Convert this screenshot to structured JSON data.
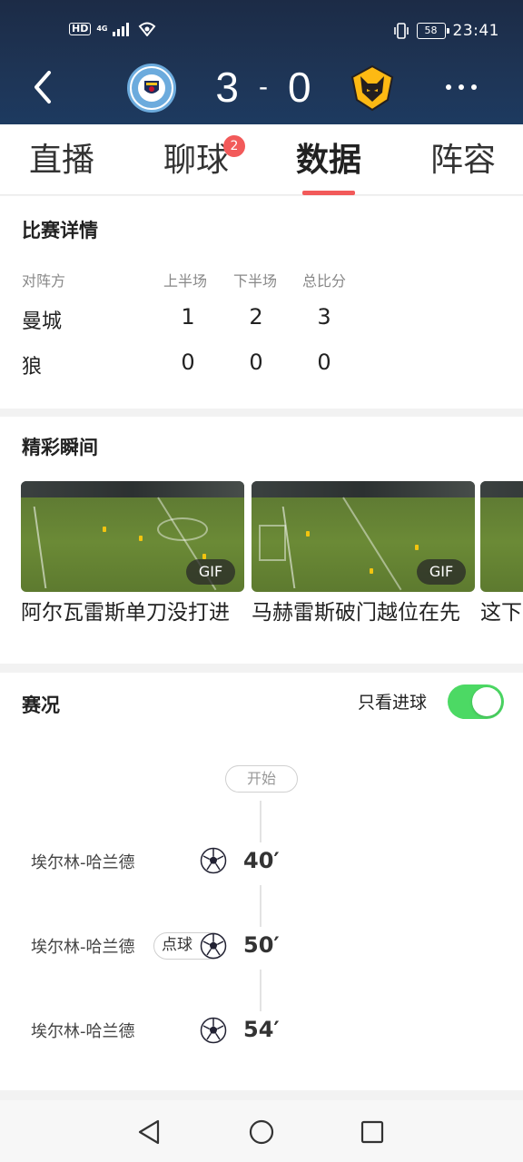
{
  "status_bar": {
    "hd": "HD",
    "net": "4G",
    "battery": "58",
    "time": "23:41"
  },
  "header": {
    "home_score": "3",
    "separator": "-",
    "away_score": "0",
    "home_logo": "manchester-city-crest",
    "away_logo": "wolves-crest"
  },
  "tabs": [
    {
      "label": "直播"
    },
    {
      "label": "聊球",
      "badge": "2"
    },
    {
      "label": "数据",
      "active": true
    },
    {
      "label": "阵容"
    }
  ],
  "details": {
    "title": "比赛详情",
    "headers": [
      "对阵方",
      "上半场",
      "下半场",
      "总比分"
    ],
    "rows": [
      {
        "team": "曼城",
        "h1": "1",
        "h2": "2",
        "total": "3"
      },
      {
        "team": "狼",
        "h1": "0",
        "h2": "0",
        "total": "0"
      }
    ]
  },
  "highlights": {
    "title": "精彩瞬间",
    "items": [
      {
        "caption": "阿尔瓦雷斯单刀没打进",
        "badge": "GIF"
      },
      {
        "caption": "马赫雷斯破门越位在先",
        "badge": "GIF"
      },
      {
        "caption": "这下"
      }
    ]
  },
  "events": {
    "title": "赛况",
    "toggle_label": "只看进球",
    "toggle_on": true,
    "start_label": "开始",
    "items": [
      {
        "player": "埃尔林-哈兰德",
        "minute": "40′",
        "type": "goal"
      },
      {
        "player": "埃尔林-哈兰德",
        "minute": "50′",
        "type": "penalty",
        "tag": "点球"
      },
      {
        "player": "埃尔林-哈兰德",
        "minute": "54′",
        "type": "goal"
      }
    ]
  },
  "colors": {
    "header_bg": "#1e3556",
    "accent_red": "#f25a5a",
    "toggle_green": "#4cd964"
  }
}
